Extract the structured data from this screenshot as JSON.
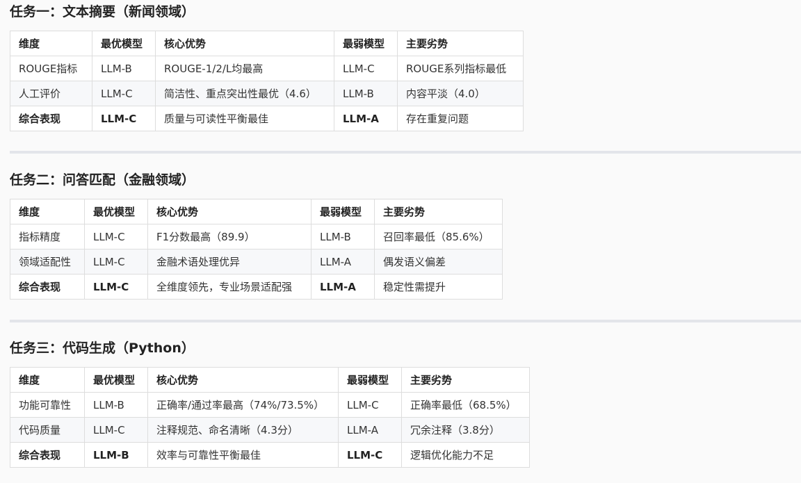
{
  "sections": [
    {
      "title": "任务一：文本摘要（新闻领域）",
      "headers": [
        "维度",
        "最优模型",
        "核心优势",
        "最弱模型",
        "主要劣势"
      ],
      "rows": [
        [
          "ROUGE指标",
          "LLM-B",
          "ROUGE-1/2/L均最高",
          "LLM-C",
          "ROUGE系列指标最低"
        ],
        [
          "人工评价",
          "LLM-C",
          "简洁性、重点突出性最优（4.6）",
          "LLM-B",
          "内容平淡（4.0）"
        ],
        [
          "综合表现",
          "LLM-C",
          "质量与可读性平衡最佳",
          "LLM-A",
          "存在重复问题"
        ]
      ]
    },
    {
      "title": "任务二：问答匹配（金融领域）",
      "headers": [
        "维度",
        "最优模型",
        "核心优势",
        "最弱模型",
        "主要劣势"
      ],
      "rows": [
        [
          "指标精度",
          "LLM-C",
          "F1分数最高（89.9）",
          "LLM-B",
          "召回率最低（85.6%）"
        ],
        [
          "领域适配性",
          "LLM-C",
          "金融术语处理优异",
          "LLM-A",
          "偶发语义偏差"
        ],
        [
          "综合表现",
          "LLM-C",
          "全维度领先，专业场景适配强",
          "LLM-A",
          "稳定性需提升"
        ]
      ]
    },
    {
      "title": "任务三：代码生成（Python）",
      "headers": [
        "维度",
        "最优模型",
        "核心优势",
        "最弱模型",
        "主要劣势"
      ],
      "rows": [
        [
          "功能可靠性",
          "LLM-B",
          "正确率/通过率最高（74%/73.5%）",
          "LLM-C",
          "正确率最低（68.5%）"
        ],
        [
          "代码质量",
          "LLM-C",
          "注释规范、命名清晰（4.3分）",
          "LLM-A",
          "冗余注释（3.8分）"
        ],
        [
          "综合表现",
          "LLM-B",
          "效率与可靠性平衡最佳",
          "LLM-C",
          "逻辑优化能力不足"
        ]
      ]
    }
  ]
}
